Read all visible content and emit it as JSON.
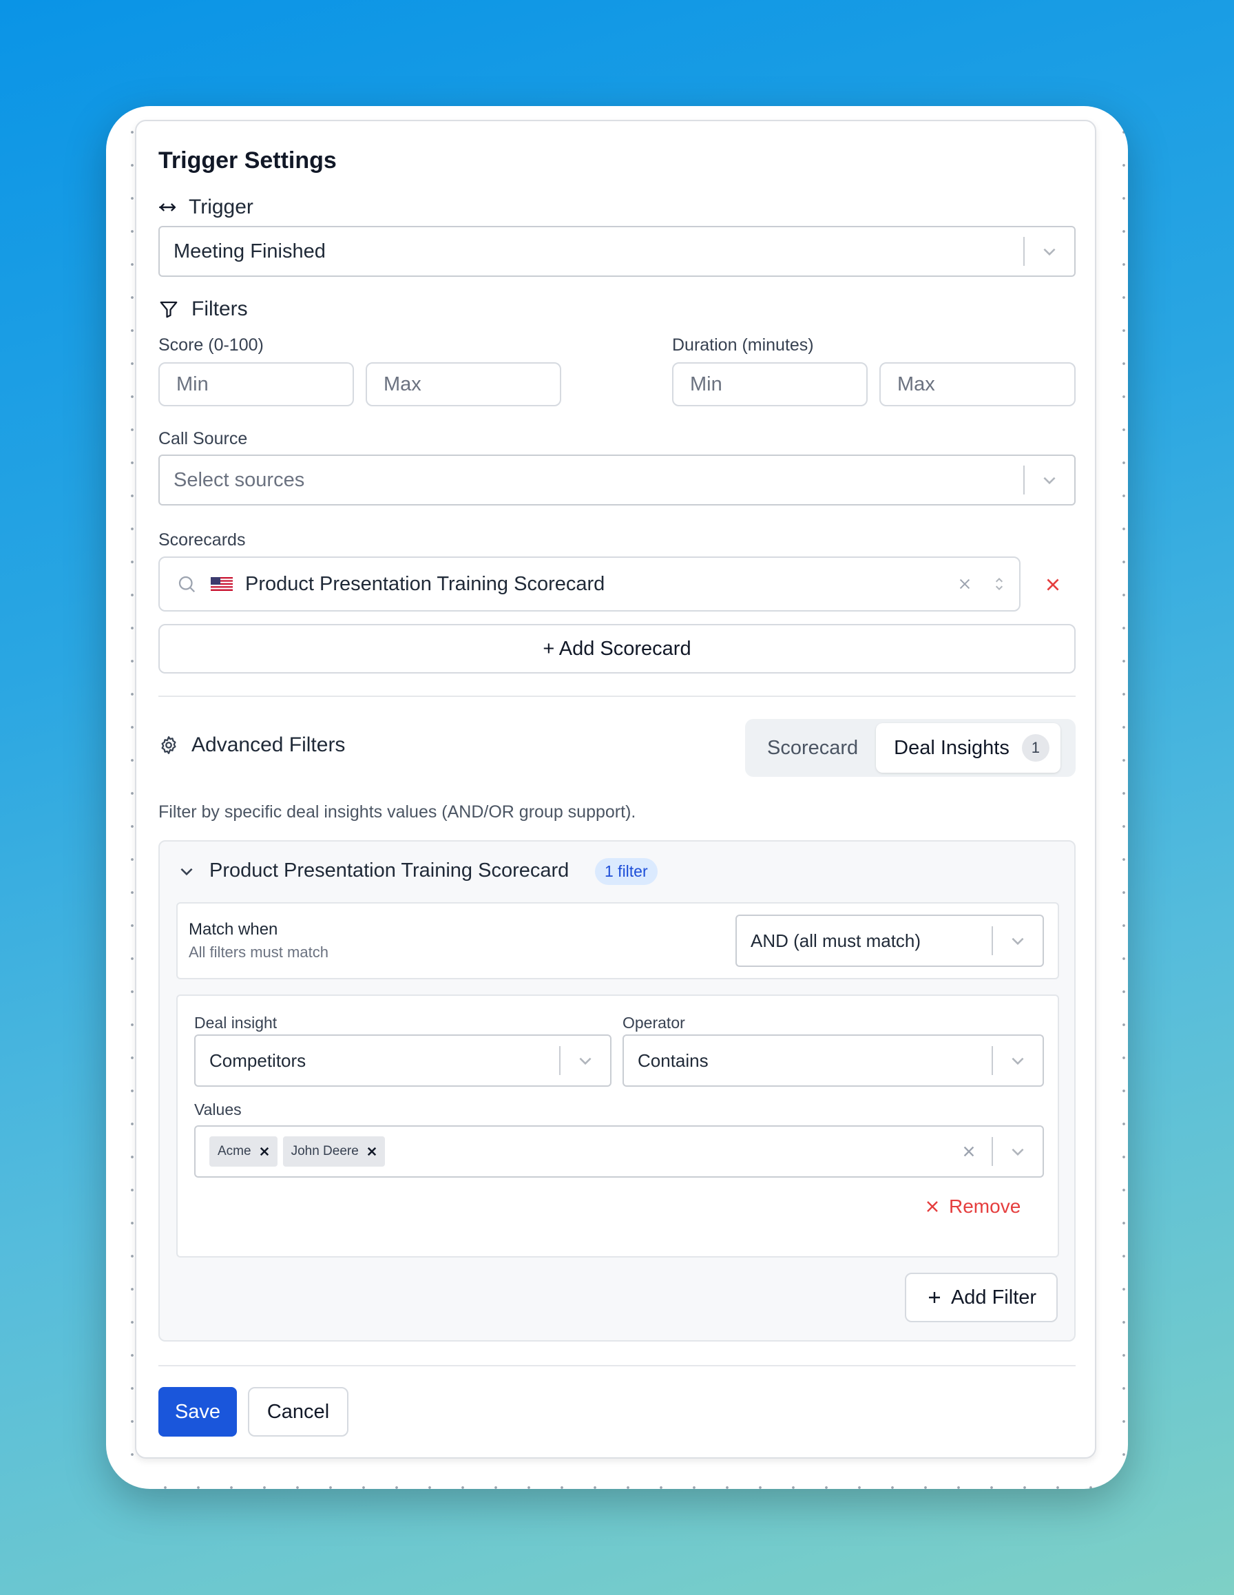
{
  "title": "Trigger Settings",
  "trigger": {
    "label": "Trigger",
    "value": "Meeting Finished"
  },
  "filters": {
    "label": "Filters",
    "score": {
      "label": "Score (0-100)",
      "min_placeholder": "Min",
      "max_placeholder": "Max"
    },
    "duration": {
      "label": "Duration (minutes)",
      "min_placeholder": "Min",
      "max_placeholder": "Max"
    },
    "call_source": {
      "label": "Call Source",
      "placeholder": "Select sources"
    },
    "scorecards": {
      "label": "Scorecards",
      "selected": "Product Presentation Training Scorecard",
      "add_label": "+ Add Scorecard"
    }
  },
  "advanced": {
    "label": "Advanced Filters",
    "tabs": [
      {
        "label": "Scorecard",
        "active": false
      },
      {
        "label": "Deal Insights",
        "active": true,
        "count": "1"
      }
    ],
    "description": "Filter by specific deal insights values (AND/OR group support).",
    "group": {
      "title": "Product Presentation Training Scorecard",
      "badge": "1 filter",
      "match_title": "Match when",
      "match_subtitle": "All filters must match",
      "match_value": "AND (all must match)",
      "filter": {
        "deal_insight_label": "Deal insight",
        "deal_insight_value": "Competitors",
        "operator_label": "Operator",
        "operator_value": "Contains",
        "values_label": "Values",
        "values": [
          "Acme",
          "John Deere"
        ],
        "remove_label": "Remove"
      },
      "add_filter_label": "Add Filter"
    }
  },
  "footer": {
    "save_label": "Save",
    "cancel_label": "Cancel"
  },
  "colors": {
    "primary": "#1a56db",
    "danger": "#e53e3e",
    "badge_bg": "#dbeafe",
    "badge_text": "#1d4ed8"
  }
}
